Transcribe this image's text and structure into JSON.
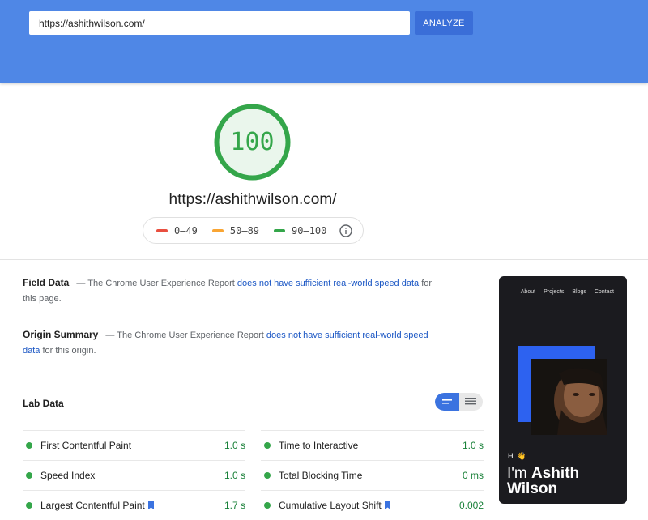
{
  "search": {
    "url_value": "https://ashithwilson.com/",
    "analyze_label": "ANALYZE"
  },
  "score": {
    "value": "100",
    "value_fraction": 1.0,
    "color": "#34a64a",
    "tested_url": "https://ashithwilson.com/"
  },
  "legend": {
    "items": [
      {
        "label": "0–49",
        "color": "#e94f3f"
      },
      {
        "label": "50–89",
        "color": "#f9a533"
      },
      {
        "label": "90–100",
        "color": "#34a64a"
      }
    ]
  },
  "field_data": {
    "title": "Field Data",
    "prefix": "— The Chrome User Experience Report",
    "link": "does not have sufficient real-world speed data",
    "suffix": "for this page."
  },
  "origin_summary": {
    "title": "Origin Summary",
    "prefix": "— The Chrome User Experience Report",
    "link": "does not have sufficient real-world speed data",
    "suffix": "for this origin."
  },
  "lab_data": {
    "title": "Lab Data",
    "left_metrics": [
      {
        "label": "First Contentful Paint",
        "value": "1.0 s",
        "bookmark": false
      },
      {
        "label": "Speed Index",
        "value": "1.0 s",
        "bookmark": false
      },
      {
        "label": "Largest Contentful Paint",
        "value": "1.7 s",
        "bookmark": true
      }
    ],
    "right_metrics": [
      {
        "label": "Time to Interactive",
        "value": "1.0 s",
        "bookmark": false
      },
      {
        "label": "Total Blocking Time",
        "value": "0 ms",
        "bookmark": false
      },
      {
        "label": "Cumulative Layout Shift",
        "value": "0.002",
        "bookmark": true
      }
    ]
  },
  "thumbnail": {
    "nav": [
      "About",
      "Projects",
      "Blogs",
      "Contact"
    ],
    "greeting": "Hi 👋",
    "name_prefix": "I'm",
    "name_first": "Ashith",
    "name_last": "Wilson"
  },
  "colors": {
    "header": "#4f87e6",
    "button": "#3a6ed8",
    "pass": "#34a64a",
    "link": "#1a56c4"
  }
}
